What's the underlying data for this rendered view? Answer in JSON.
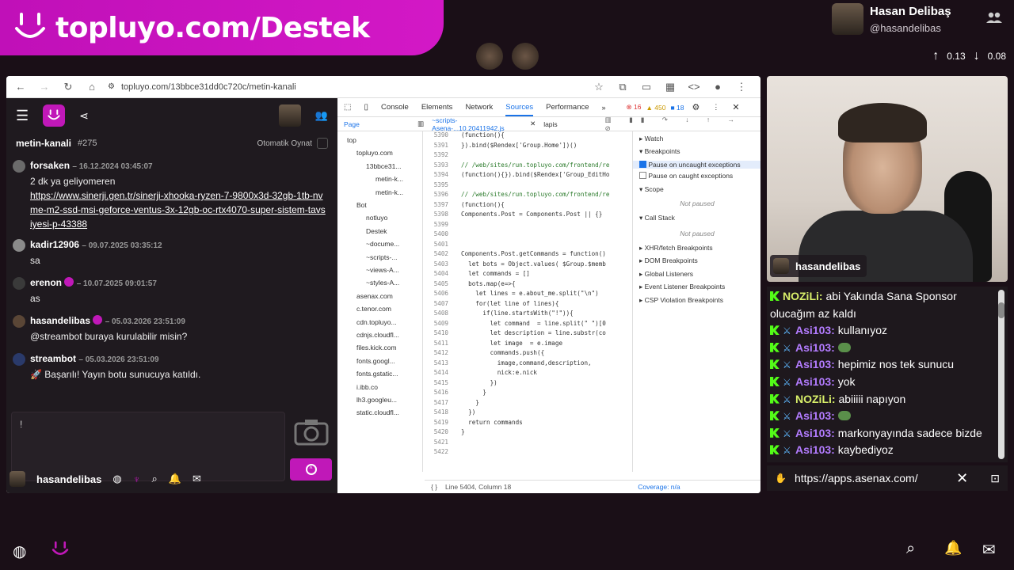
{
  "banner": {
    "text": "topluyo.com/Destek"
  },
  "streamer": {
    "name": "Hasan Delibaş",
    "handle": "@hasandelibas",
    "stat_up": "0.13",
    "stat_down": "0.08"
  },
  "browser": {
    "url": "topluyo.com/13bbce31dd0c720c/metin-kanali"
  },
  "chatapp": {
    "channel": "metin-kanali",
    "channel_num": "#275",
    "auto_label": "Otomatik Oynat",
    "messages": [
      {
        "user": "forsaken",
        "time": "– 16.12.2024 03:45:07",
        "text": "2 dk ya geliyomeren",
        "link": "https://www.sinerji.gen.tr/sinerji-xhooka-ryzen-7-9800x3d-32gb-1tb-nvme-m2-ssd-msi-geforce-ventus-3x-12gb-oc-rtx4070-super-sistem-tavsiyesi-p-43388"
      },
      {
        "user": "kadir12906",
        "time": "– 09.07.2025 03:35:12",
        "text": "sa"
      },
      {
        "user": "erenon",
        "time": "– 10.07.2025 09:01:57",
        "text": "as"
      },
      {
        "user": "hasandelibas",
        "time": "– 05.03.2026 23:51:09",
        "text": "@streambot  buraya kurulabilir misin?"
      },
      {
        "user": "streambot",
        "time": "– 05.03.2026 23:51:09",
        "text": "🚀 Başarılı! Yayın botu sunucuya katıldı."
      }
    ],
    "input_text": "!",
    "bottom_user": "hasandelibas"
  },
  "devtools": {
    "tabs": [
      "Console",
      "Elements",
      "Network",
      "Sources",
      "Performance"
    ],
    "active_tab": "Sources",
    "errors": "16",
    "warnings": "450",
    "info": "18",
    "sub_page": "Page",
    "file_tab": "~scripts-Asena-...10.20411942.js",
    "file_tab2": "lapis",
    "tree": [
      "top",
      "topluyo.com",
      "13bbce31...",
      "metin-k...",
      "metin-k...",
      "Bot",
      "notluyo",
      "Destek",
      "~docume...",
      "~scripts-...",
      "~views-A...",
      "~styles-A...",
      "asenax.com",
      "c.tenor.com",
      "cdn.topluyo...",
      "cdnjs.cloudfl...",
      "files.kick.com",
      "fonts.googl...",
      "fonts.gstatic...",
      "i.ibb.co",
      "lh3.googleu...",
      "static.cloudfl..."
    ],
    "code_lines": [
      {
        "n": "5390",
        "t": "(function(){"
      },
      {
        "n": "5391",
        "t": "}).bind($Rendex['Group.Home'])()"
      },
      {
        "n": "5392",
        "t": ""
      },
      {
        "n": "5393",
        "t": "// /web/sites/run.topluyo.com/frontend/re"
      },
      {
        "n": "5394",
        "t": "(function(){}).bind($Rendex['Group_EditHo"
      },
      {
        "n": "5395",
        "t": ""
      },
      {
        "n": "5396",
        "t": "// /web/sites/run.topluyo.com/frontend/re"
      },
      {
        "n": "5397",
        "t": "(function(){"
      },
      {
        "n": "5398",
        "t": "Components.Post = Components.Post || {}"
      },
      {
        "n": "5399",
        "t": ""
      },
      {
        "n": "5400",
        "t": ""
      },
      {
        "n": "5401",
        "t": ""
      },
      {
        "n": "5402",
        "t": "Components.Post.getCommands = function()"
      },
      {
        "n": "5403",
        "t": "  let bots = Object.values( $Group.$memb"
      },
      {
        "n": "5404",
        "t": "  let commands = []"
      },
      {
        "n": "5405",
        "t": "  bots.map(e=>{"
      },
      {
        "n": "5406",
        "t": "    let lines = e.about_me.split(\"\\n\")"
      },
      {
        "n": "5407",
        "t": "    for(let line of lines){"
      },
      {
        "n": "5408",
        "t": "      if(line.startsWith(\"!\")){"
      },
      {
        "n": "5409",
        "t": "        let command  = line.split(\" \")[0"
      },
      {
        "n": "5410",
        "t": "        let description = line.substr(co"
      },
      {
        "n": "5411",
        "t": "        let image  = e.image"
      },
      {
        "n": "5412",
        "t": "        commands.push({"
      },
      {
        "n": "5413",
        "t": "          image,command,description,"
      },
      {
        "n": "5414",
        "t": "          nick:e.nick"
      },
      {
        "n": "5415",
        "t": "        })"
      },
      {
        "n": "5416",
        "t": "      }"
      },
      {
        "n": "5417",
        "t": "    }"
      },
      {
        "n": "5418",
        "t": "  })"
      },
      {
        "n": "5419",
        "t": "  return commands"
      },
      {
        "n": "5420",
        "t": "}"
      },
      {
        "n": "5421",
        "t": ""
      },
      {
        "n": "5422",
        "t": ""
      }
    ],
    "right": {
      "watch": "Watch",
      "breakpoints": "Breakpoints",
      "pause_uncaught": "Pause on uncaught exceptions",
      "pause_caught": "Pause on caught exceptions",
      "scope": "Scope",
      "not_paused": "Not paused",
      "call_stack": "Call Stack",
      "not_paused2": "Not paused",
      "xhr": "XHR/fetch Breakpoints",
      "dom": "DOM Breakpoints",
      "global": "Global Listeners",
      "event": "Event Listener Breakpoints",
      "csp": "CSP Violation Breakpoints"
    },
    "status_line": "Line 5404, Column 18",
    "coverage": "Coverage: n/a"
  },
  "webcam": {
    "label": "hasandelibas"
  },
  "twitch_chat": [
    {
      "user": "NOZiLi",
      "text": "abi Yakında Sana Sponsor",
      "cont": "olucağım az kaldı",
      "color": "#d9f06a",
      "badges": false
    },
    {
      "user": "Asi103",
      "text": "kullanıyoz",
      "color": "#b37cff",
      "badges": true
    },
    {
      "user": "Asi103",
      "text": "",
      "color": "#b37cff",
      "badges": true,
      "emote": true
    },
    {
      "user": "Asi103",
      "text": "hepimiz nos tek sunucu",
      "color": "#b37cff",
      "badges": true
    },
    {
      "user": "Asi103",
      "text": "yok",
      "color": "#b37cff",
      "badges": true
    },
    {
      "user": "NOZiLi",
      "text": "abiiiii napıyon",
      "color": "#d9f06a",
      "badges": true
    },
    {
      "user": "Asi103",
      "text": "",
      "color": "#b37cff",
      "badges": true,
      "emote": true
    },
    {
      "user": "Asi103",
      "text": "markonyayında sadece bizde",
      "color": "#b37cff",
      "badges": true
    },
    {
      "user": "Asi103",
      "text": "kaybediyoz",
      "color": "#b37cff",
      "badges": true
    }
  ],
  "overlay_url": "https://apps.asenax.com/",
  "colors": {
    "accent": "#c018b8",
    "kick_green": "#53fc18"
  }
}
